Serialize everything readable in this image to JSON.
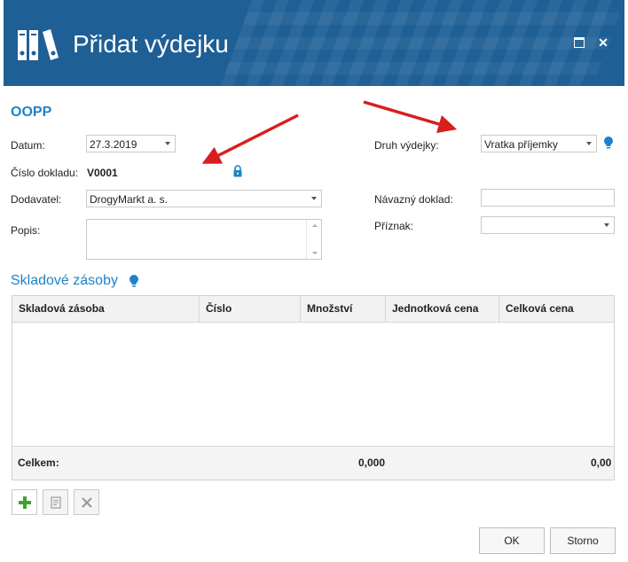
{
  "window": {
    "title": "Přidat výdejku"
  },
  "section": {
    "title": "OOPP"
  },
  "form": {
    "datum_label": "Datum:",
    "datum_value": "27.3.2019",
    "cislo_label": "Číslo dokladu:",
    "cislo_value": "V0001",
    "dodavatel_label": "Dodavatel:",
    "dodavatel_value": "DrogyMarkt a. s.",
    "popis_label": "Popis:",
    "popis_value": "",
    "druh_label": "Druh výdejky:",
    "druh_value": "Vratka příjemky",
    "navazny_label": "Návazný doklad:",
    "navazny_value": "",
    "priznak_label": "Příznak:",
    "priznak_value": ""
  },
  "stock": {
    "title": "Skladové zásoby",
    "columns": [
      "Skladová zásoba",
      "Číslo",
      "Množství",
      "Jednotková cena",
      "Celková cena"
    ],
    "rows": [],
    "footer": {
      "label": "Celkem:",
      "quantity_total": "0,000",
      "price_total": "0,00"
    }
  },
  "buttons": {
    "ok": "OK",
    "cancel": "Storno"
  },
  "colors": {
    "header_bg": "#1e5f96",
    "accent": "#1e82c8",
    "annotation_arrow": "#d81e1e",
    "add_icon": "#3aa52a"
  },
  "icons": [
    "binders-logo-icon",
    "maximize-icon",
    "close-icon",
    "lock-icon",
    "lightbulb-icon",
    "add-icon",
    "edit-icon",
    "delete-icon"
  ]
}
